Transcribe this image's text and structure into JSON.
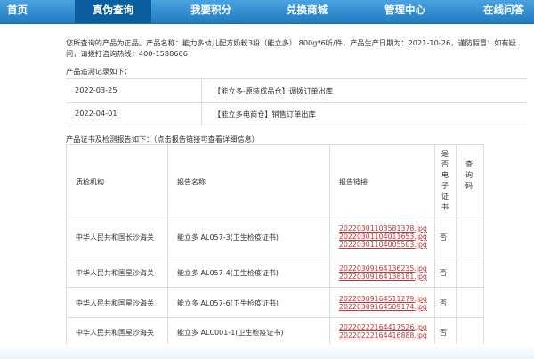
{
  "nav": {
    "items": [
      {
        "label": "首页"
      },
      {
        "label": "真伪查询",
        "active": true
      },
      {
        "label": "我要积分"
      },
      {
        "label": "兑换商城"
      },
      {
        "label": "管理中心"
      },
      {
        "label": "在线问答"
      }
    ]
  },
  "intro_text": "您所查询的产品为正品。产品名称：能力多幼儿配方奶粉3段（能立多） 800g*6听/件，产品生产日期为：2021-10-26，谨防假冒！如有疑问，请拨打咨询热线：400-1588666",
  "trace": {
    "title": "产品追溯记录如下：",
    "rows": [
      {
        "date": "2022-03-25",
        "event": "【能立多-原装成品仓】调拨订单出库"
      },
      {
        "date": "2022-04-01",
        "event": "【能立多电商仓】销售订单出库"
      }
    ]
  },
  "cert": {
    "title": "产品证书及检测报告如下：（点击报告链接可查看详细信息）",
    "headers": {
      "org": "质检机构",
      "name": "报告名称",
      "link": "报告链接",
      "e_cert": "是\n否\n电\n子\n证\n书",
      "code": "查\n询\n码"
    },
    "rows": [
      {
        "org": "中华人民共和国长沙海关",
        "name": "能立多 AL057-3(卫生检疫证书)",
        "links": [
          "20220301103581378.jpg",
          "20220301104011653.jpg",
          "20220301104005503.jpg"
        ],
        "e_cert": "否",
        "code": ""
      },
      {
        "org": "中华人民共和国星沙海关",
        "name": "能立多 AL057-4(卫生检疫证书)",
        "links": [
          "20220309164136235.jpg",
          "20220309164138181.jpg"
        ],
        "e_cert": "否",
        "code": ""
      },
      {
        "org": "中华人民共和国星沙海关",
        "name": "能立多 AL057-6(卫生检疫证书)",
        "links": [
          "20220309164511279.jpg",
          "20220309164509174.jpg"
        ],
        "e_cert": "否",
        "code": ""
      },
      {
        "org": "中华人民共和国星沙海关",
        "name": "能立多 ALC001-1(卫生检疫证书)",
        "links": [
          "20220222164417526.jpg",
          "20220222164416888.jpg"
        ],
        "e_cert": "否",
        "code": ""
      }
    ]
  }
}
